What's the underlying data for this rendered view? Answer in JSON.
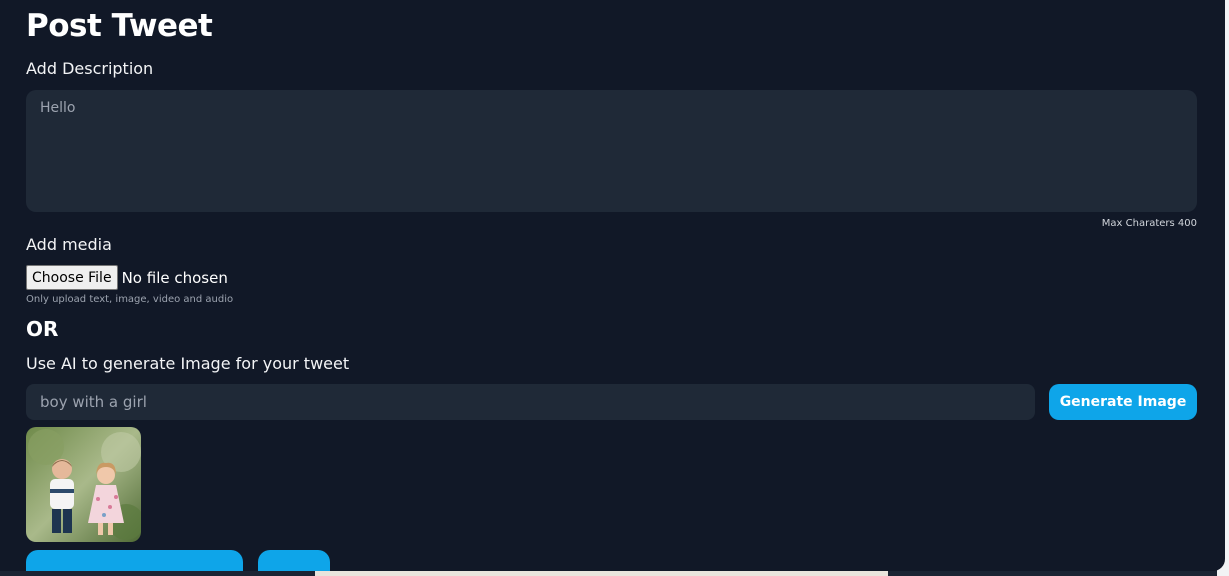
{
  "modal": {
    "title": "Post Tweet",
    "description_label": "Add Description",
    "description_value": "Hello",
    "max_chars_text": "Max Charaters 400",
    "media_label": "Add media",
    "choose_file_label": "Choose File",
    "no_file_text": "No file chosen",
    "upload_hint": "Only upload text, image, video and audio",
    "or_text": "OR",
    "ai_label": "Use AI to generate Image for your tweet",
    "ai_prompt_value": "boy with a girl",
    "generate_button_label": "Generate Image"
  },
  "colors": {
    "modal_bg": "#111827",
    "input_bg": "#1f2937",
    "accent": "#0ea5e9"
  }
}
